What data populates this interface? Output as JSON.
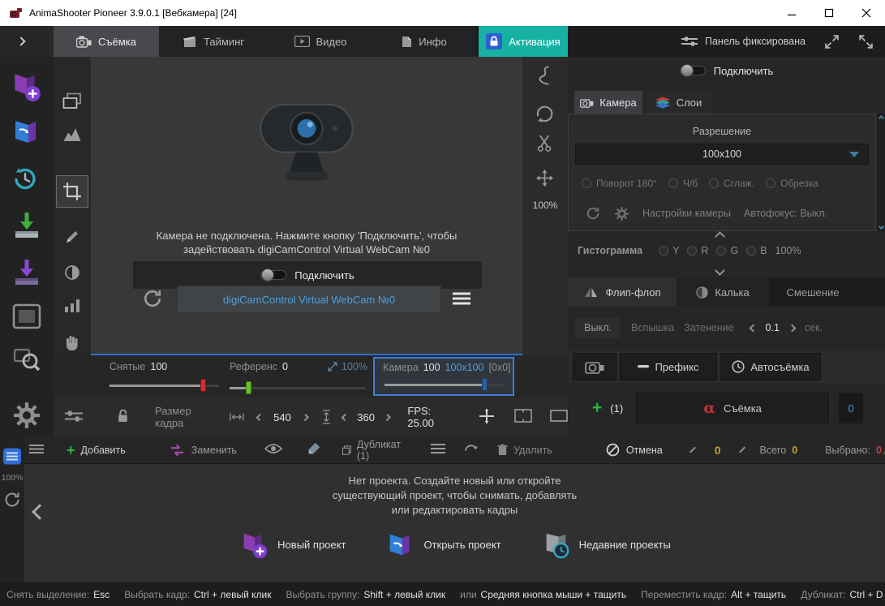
{
  "titlebar": {
    "title": "AnimaShooter Pioneer 3.9.0.1 [Вебкамера] [24]"
  },
  "tabbar": {
    "tabs": [
      {
        "label": "Съёмка"
      },
      {
        "label": "Тайминг"
      },
      {
        "label": "Видео"
      },
      {
        "label": "Инфо"
      }
    ],
    "activation_label": "Активация",
    "panel_fixed_label": "Панель фиксирована"
  },
  "capture": {
    "message_line1": "Камера не подключена. Нажмите кнопку 'Подключить', чтобы",
    "message_line2": "задействовать digiCamControl Virtual WebCam №0",
    "connect_label": "Подключить",
    "device_name": "digiCamControl Virtual WebCam №0",
    "side_zoom": "100%",
    "captured_label": "Снятые",
    "captured_value": "100",
    "reference_label": "Референс",
    "reference_value": "0",
    "reference_zoom": "100%",
    "camera_label": "Камера",
    "camera_value": "100",
    "camera_size": "100x100",
    "camera_offset": "[0x0]"
  },
  "framebar": {
    "size_label": "Размер кадра",
    "width": "540",
    "height": "360",
    "fps": "FPS: 25.00"
  },
  "panel": {
    "connect_label": "Подключить",
    "tab_camera": "Камера",
    "tab_layers": "Слои",
    "resolution_label": "Разрешение",
    "resolution_value": "100x100",
    "opt_rotate": "Поворот 180°",
    "opt_bw": "Ч/б",
    "opt_smooth": "Сглаж.",
    "opt_crop": "Обрезка",
    "camera_settings_label": "Настройки камеры",
    "autofocus_label": "Автофокус: Выкл.",
    "histogram_label": "Гистограмма",
    "hist_channels": [
      {
        "label": "Y"
      },
      {
        "label": "R"
      },
      {
        "label": "G"
      },
      {
        "label": "B"
      }
    ],
    "hist_percent": "100%",
    "tab_flipflop": "Флип-флоп",
    "tab_tracing": "Калька",
    "tab_blend": "Смешение",
    "off_button": "Выкл.",
    "flash_label": "Вспышка",
    "shading_label": "Затенение",
    "interval_value": "0.1",
    "sec_label": "сек.",
    "prefix_label": "Префикс",
    "autoshoot_label": "Автосъёмка",
    "add_count": "(1)",
    "shoot_label": "Съёмка",
    "shoot_counter": "0"
  },
  "timeline": {
    "add_label": "Добавить",
    "replace_label": "Заменить",
    "duplicate_label": "Дубликат (1)",
    "delete_label": "Удалить",
    "cancel_label": "Отмена",
    "nav_value": "0",
    "total_label": "Всего",
    "total_value": "0",
    "selected_label": "Выбрано:",
    "selected_value": "0",
    "zoom": "100%",
    "empty_line1": "Нет проекта. Создайте новый или откройте",
    "empty_line2": "существующий проект, чтобы снимать, добавлять",
    "empty_line3": "или редактировать кадры",
    "new_project_label": "Новый проект",
    "open_project_label": "Открыть проект",
    "recent_projects_label": "Недавние проекты"
  },
  "statusbar": {
    "items": [
      {
        "label": "Снять выделение:",
        "value": "Esc"
      },
      {
        "label": "Выбрать кадр:",
        "value": "Ctrl + левый клик"
      },
      {
        "label": "Выбрать группу:",
        "value": "Shift + левый клик"
      },
      {
        "label": "или",
        "value": "Средняя кнопка мыши + тащить"
      },
      {
        "label": "Переместить кадр:",
        "value": "Alt + тащить"
      },
      {
        "label": "Дубликат:",
        "value": "Ctrl + D"
      }
    ]
  },
  "colors": {
    "activation_teal": "#16b1a3",
    "accent_blue": "#4da0e0",
    "selection_border_blue": "#3f7fd4",
    "count_yellow": "#c79f2e",
    "selected_red": "#c24444",
    "handle_red": "#d03030",
    "handle_green": "#63c427",
    "handle_blue": "#2e5f9e",
    "shoot_alpha_red": "#c03434"
  }
}
